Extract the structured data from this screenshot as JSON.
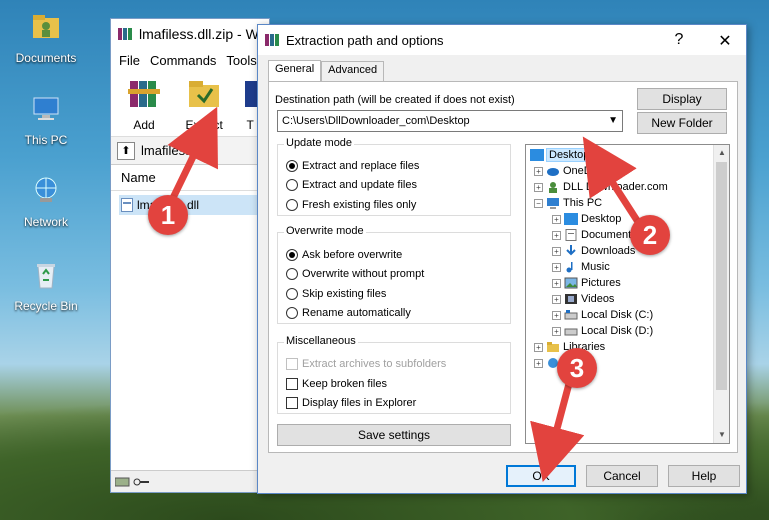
{
  "desktop": {
    "icons": [
      {
        "label": "Documents"
      },
      {
        "label": "This PC"
      },
      {
        "label": "Network"
      },
      {
        "label": "Recycle Bin"
      }
    ]
  },
  "winrar": {
    "title": "lmafiless.dll.zip - Wi",
    "menu": [
      "File",
      "Commands",
      "Tools"
    ],
    "toolbar": {
      "add": "Add",
      "extract_to": "Extract To",
      "partial": "T"
    },
    "path": "lmafiless.dll",
    "column_name": "Name",
    "file": "lmafiless.dll"
  },
  "dialog": {
    "title": "Extraction path and options",
    "help_glyph": "?",
    "close_glyph": "✕",
    "tabs": [
      "General",
      "Advanced"
    ],
    "dest_label": "Destination path (will be created if does not exist)",
    "dest_value": "C:\\Users\\DllDownloader_com\\Desktop",
    "display_btn": "Display",
    "new_folder_btn": "New Folder",
    "update_mode": {
      "title": "Update mode",
      "options": [
        "Extract and replace files",
        "Extract and update files",
        "Fresh existing files only"
      ],
      "selected": 0
    },
    "overwrite_mode": {
      "title": "Overwrite mode",
      "options": [
        "Ask before overwrite",
        "Overwrite without prompt",
        "Skip existing files",
        "Rename automatically"
      ],
      "selected": 0
    },
    "misc": {
      "title": "Miscellaneous",
      "options": [
        "Extract archives to subfolders",
        "Keep broken files",
        "Display files in Explorer"
      ]
    },
    "save_settings": "Save settings",
    "tree": [
      {
        "label": "Desktop"
      },
      {
        "label": "OneD"
      },
      {
        "label": "DLL Downloader.com"
      },
      {
        "label": "This PC"
      },
      {
        "label": "Desktop"
      },
      {
        "label": "Document"
      },
      {
        "label": "Downloads"
      },
      {
        "label": "Music"
      },
      {
        "label": "Pictures"
      },
      {
        "label": "Videos"
      },
      {
        "label": "Local Disk (C:)"
      },
      {
        "label": "Local Disk (D:)"
      },
      {
        "label": "Libraries"
      },
      {
        "label": "ork"
      }
    ],
    "ok": "OK",
    "cancel": "Cancel",
    "help": "Help"
  },
  "annotations": [
    "1",
    "2",
    "3"
  ],
  "colors": {
    "annotation": "#e2433e",
    "selection": "#cce8ff",
    "default_button_border": "#0078d7"
  }
}
